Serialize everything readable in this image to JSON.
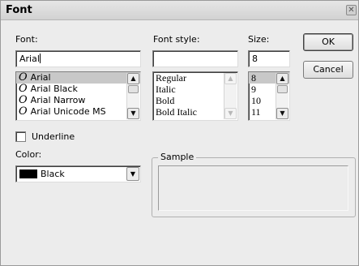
{
  "window": {
    "title": "Font",
    "close_glyph": "✕"
  },
  "font": {
    "label": "Font:",
    "value": "Arial",
    "items": [
      {
        "label": "Arial",
        "selected": true
      },
      {
        "label": "Arial Black",
        "selected": false
      },
      {
        "label": "Arial Narrow",
        "selected": false
      },
      {
        "label": "Arial Unicode MS",
        "selected": false
      }
    ],
    "item_icon": "truetype-icon"
  },
  "font_style": {
    "label": "Font style:",
    "value": "",
    "items": [
      "Regular",
      "Italic",
      "Bold",
      "Bold Italic"
    ]
  },
  "size": {
    "label": "Size:",
    "value": "8",
    "items": [
      {
        "label": "8",
        "selected": true
      },
      {
        "label": "9",
        "selected": false
      },
      {
        "label": "10",
        "selected": false
      },
      {
        "label": "11",
        "selected": false
      }
    ]
  },
  "buttons": {
    "ok": "OK",
    "cancel": "Cancel"
  },
  "underline": {
    "label": "Underline",
    "checked": false
  },
  "color": {
    "label": "Color:",
    "value": "Black",
    "swatch": "#000000"
  },
  "sample": {
    "label": "Sample",
    "text": ""
  },
  "icons": {
    "scroll_up": "▲",
    "scroll_down": "▼",
    "dropdown": "▼",
    "truetype": "O"
  },
  "colors": {
    "selection": "#c8c8c8",
    "dialog_bg": "#ececec"
  }
}
